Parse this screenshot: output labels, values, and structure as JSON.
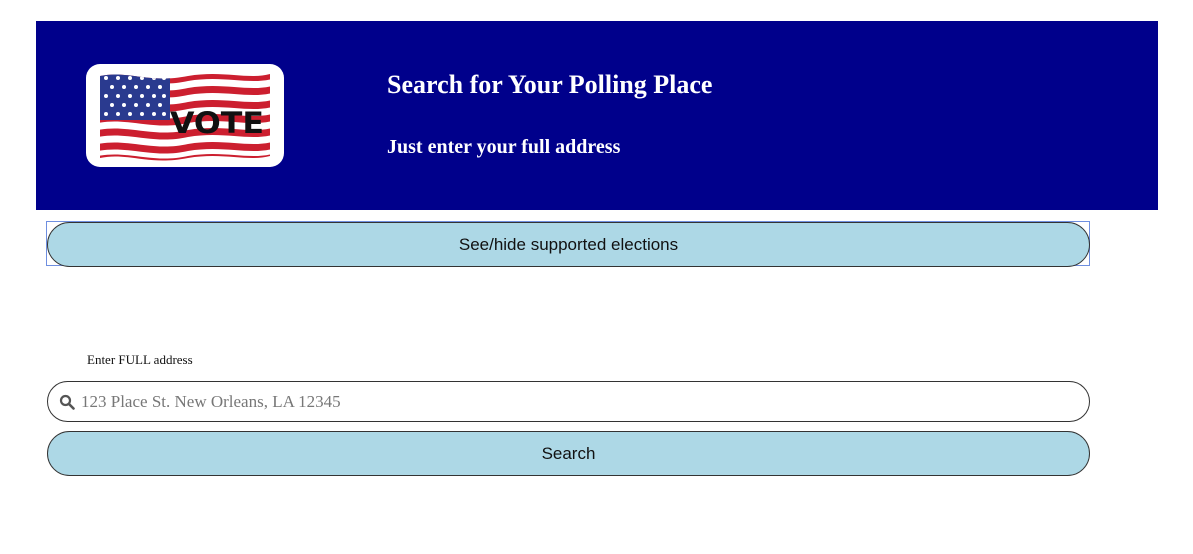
{
  "header": {
    "logo_text": "VOTE",
    "title": "Search for Your Polling Place",
    "subtitle": "Just enter your full address",
    "background_color": "#00008b"
  },
  "elections_toggle": {
    "label": "See/hide supported elections"
  },
  "address_form": {
    "label": "Enter FULL address",
    "icon": "search-icon",
    "placeholder": "123 Place St. New Orleans, LA 12345",
    "value": "",
    "search_label": "Search"
  },
  "colors": {
    "button_background": "#add8e6",
    "accent_blue": "#00008b"
  }
}
